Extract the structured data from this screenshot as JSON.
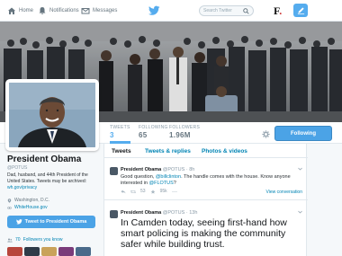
{
  "nav": {
    "home": "Home",
    "notifications": "Notifications",
    "messages": "Messages",
    "search_placeholder": "Search Twitter",
    "brand_letter": "F",
    "brand_dot": "."
  },
  "stats": [
    {
      "label": "TWEETS",
      "value": "3"
    },
    {
      "label": "FOLLOWING",
      "value": "65"
    },
    {
      "label": "FOLLOWERS",
      "value": "1.96M"
    }
  ],
  "follow_button": "Following",
  "profile": {
    "name": "President Obama",
    "handle": "@POTUS",
    "bio_text": "Dad, husband, and 44th President of the United States. Tweets may be archived: ",
    "bio_link": "wh.gov/privacy",
    "location": "Washington, D.C.",
    "website": "WhiteHouse.gov",
    "tweet_to": "Tweet to President Obama",
    "followers_know_count": "70",
    "followers_know_label": "Followers you know"
  },
  "timeline": {
    "tabs": [
      "Tweets",
      "Tweets & replies",
      "Photos & videos"
    ],
    "tweets": [
      {
        "name": "President Obama",
        "handle": "@POTUS",
        "time": "· 8h",
        "text_prefix": "Good question, ",
        "mention": "@billclinton",
        "text_mid": ". The handle comes with the house. Know anyone interested in ",
        "mention2": "@FLOTUS",
        "text_suffix": "?",
        "retweets": "53",
        "favorites": "95k",
        "conversation": "View conversation"
      },
      {
        "name": "President Obama",
        "handle": "@POTUS",
        "time": "· 13h",
        "text": "In Camden today, seeing first-hand how smart policing is making the community safer while building trust."
      }
    ]
  },
  "colors": {
    "accent": "#55acee",
    "link": "#0084b4"
  }
}
